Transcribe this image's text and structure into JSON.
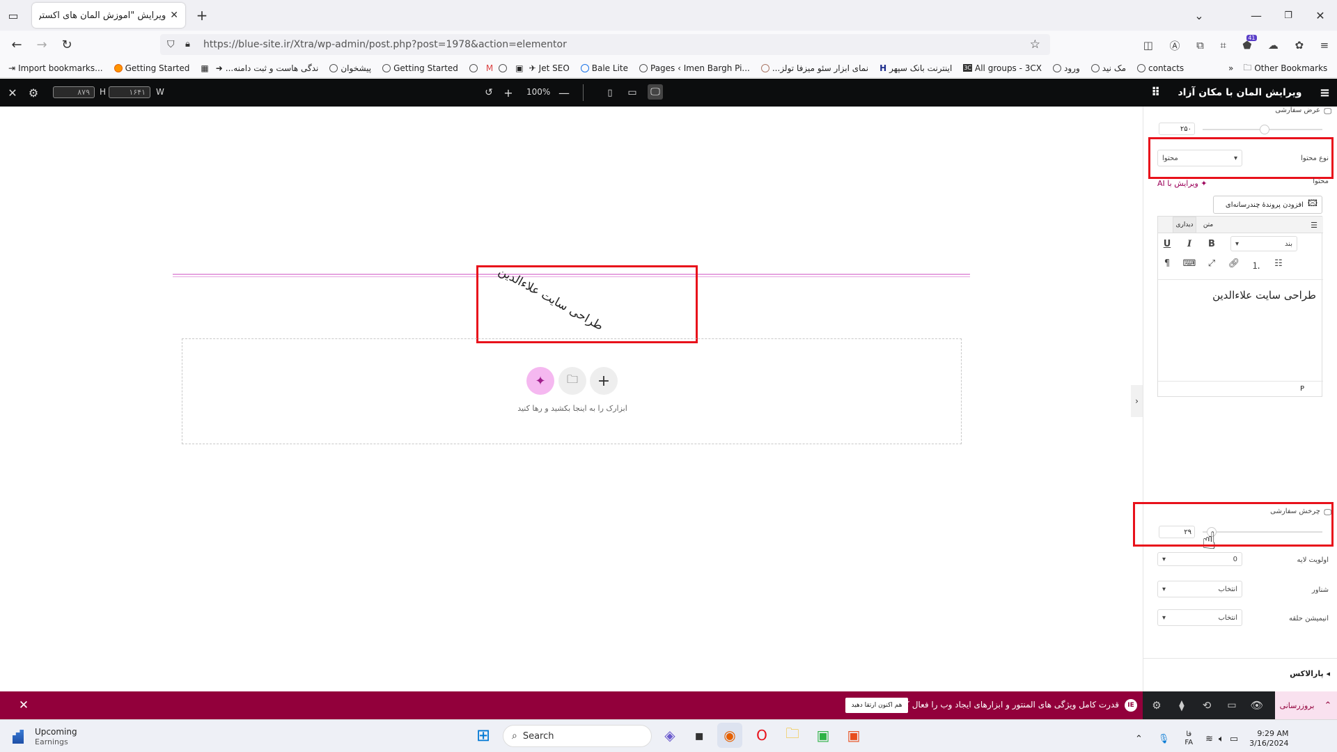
{
  "browser": {
    "tab_title": "ویرایش \"آموزش المان های اکسترا – ...",
    "url": "https://blue-site.ir/Xtra/wp-admin/post.php?post=1978&action=elementor",
    "bookmarks": [
      "Import bookmarks...",
      "Getting Started",
      "...ندگی هاست و ثبت دامنه",
      "پیشخوان",
      "Getting Started",
      "Jet SEO",
      "Bale Lite",
      "Pages ‹ Imen Bargh Pi...",
      "...نمای ابزار سئو میزفا تولز",
      "اینترنت بانک سپهر",
      "All groups - 3CX",
      "ورود",
      "مک نید",
      "contacts"
    ],
    "other_bookmarks": "Other Bookmarks",
    "badge_count": "41"
  },
  "topbar": {
    "height_label": "H",
    "width_label": "W",
    "height_value": "۸۷۹",
    "width_value": "۱۶۴۱",
    "zoom": "100%"
  },
  "panel": {
    "title": "ویرایش المان با مکان آزاد",
    "custom_width_label": "عرض سفارشی",
    "custom_width_value": "۲۵۰",
    "content_type_label": "نوع محتوا",
    "content_type_value": "محتوا",
    "content_label": "محتوا",
    "ai_edit": "ویرایش با AI",
    "add_media": "افزودن پروندهٔ چندرسانه‌ای",
    "tab_visual": "دیداری",
    "tab_text": "متن",
    "paragraph_select": "بند",
    "editor_text": "طراحی سایت علاءالدین",
    "editor_footer": "P",
    "custom_rotate_label": "چرخش سفارشی",
    "rotate_value": "۲۹",
    "z_index_label": "اولویت لایه",
    "z_index_value": "0",
    "float_label": "شناور",
    "float_value": "انتخاب",
    "loop_label": "انیمیشن حلقه",
    "loop_value": "انتخاب",
    "parallax_label": "پارالاکس"
  },
  "canvas": {
    "rotated_text": "طراحی سایت علاءالدین",
    "drop_hint": "ابزارک را به اینجا بکشید و رها کنید"
  },
  "bottom": {
    "promo_text": "قدرت کامل ویژگی های المنتور و ابزارهای ایجاد وب را فعال کنید.",
    "promo_button": "هم اکنون ارتقا دهید",
    "update_button": "بروزرسانی"
  },
  "taskbar": {
    "weather_title": "Upcoming",
    "weather_sub": "Earnings",
    "search": "Search",
    "lang_top": "فا",
    "lang_bottom": "FA",
    "time": "9:29 AM",
    "date": "3/16/2024"
  },
  "colors": {
    "red_highlight": "#e8111b",
    "promo_bg": "#92003b",
    "ai_pink": "#f5b8f0",
    "panel_purple": "#9b0059"
  }
}
